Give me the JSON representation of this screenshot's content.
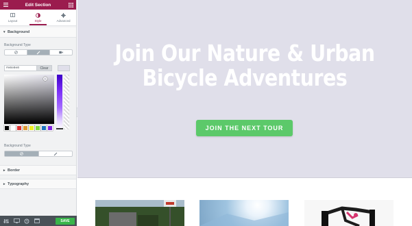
{
  "panel": {
    "title": "Edit Section",
    "tabs": [
      {
        "label": "Layout",
        "icon": "layout-icon"
      },
      {
        "label": "Style",
        "icon": "contrast-icon",
        "active": true
      },
      {
        "label": "Advanced",
        "icon": "gear-icon"
      }
    ],
    "background": {
      "section_title": "Background",
      "type_label": "Background Type",
      "type_options": [
        "none-icon",
        "brush-icon",
        "video-icon"
      ],
      "selected_type": "brush-icon",
      "color_value": "#e0dfea",
      "color_display": "#e0e0e0",
      "clear_label": "Clear",
      "palette": [
        "#000000",
        "#ffffff",
        "#dd3333",
        "#dd9933",
        "#eeee22",
        "#81d742",
        "#1e73be",
        "#8224e3"
      ],
      "type2_label": "Background Type",
      "type2_options": [
        "none-icon",
        "brush-icon"
      ]
    },
    "border_title": "Border",
    "typography_title": "Typography",
    "footer": {
      "icons": [
        "settings-icon",
        "responsive-icon",
        "history-icon",
        "preview-icon"
      ],
      "save_label": "SAVE"
    }
  },
  "hero": {
    "title": "Join Our Nature & Urban\nBicycle Adventures",
    "cta_label": "JOIN THE NEXT TOUR",
    "background": "#e0dfea",
    "cta_color": "#5cc96a"
  },
  "colors": {
    "accent": "#9b1c4e",
    "save": "#39b54a"
  }
}
